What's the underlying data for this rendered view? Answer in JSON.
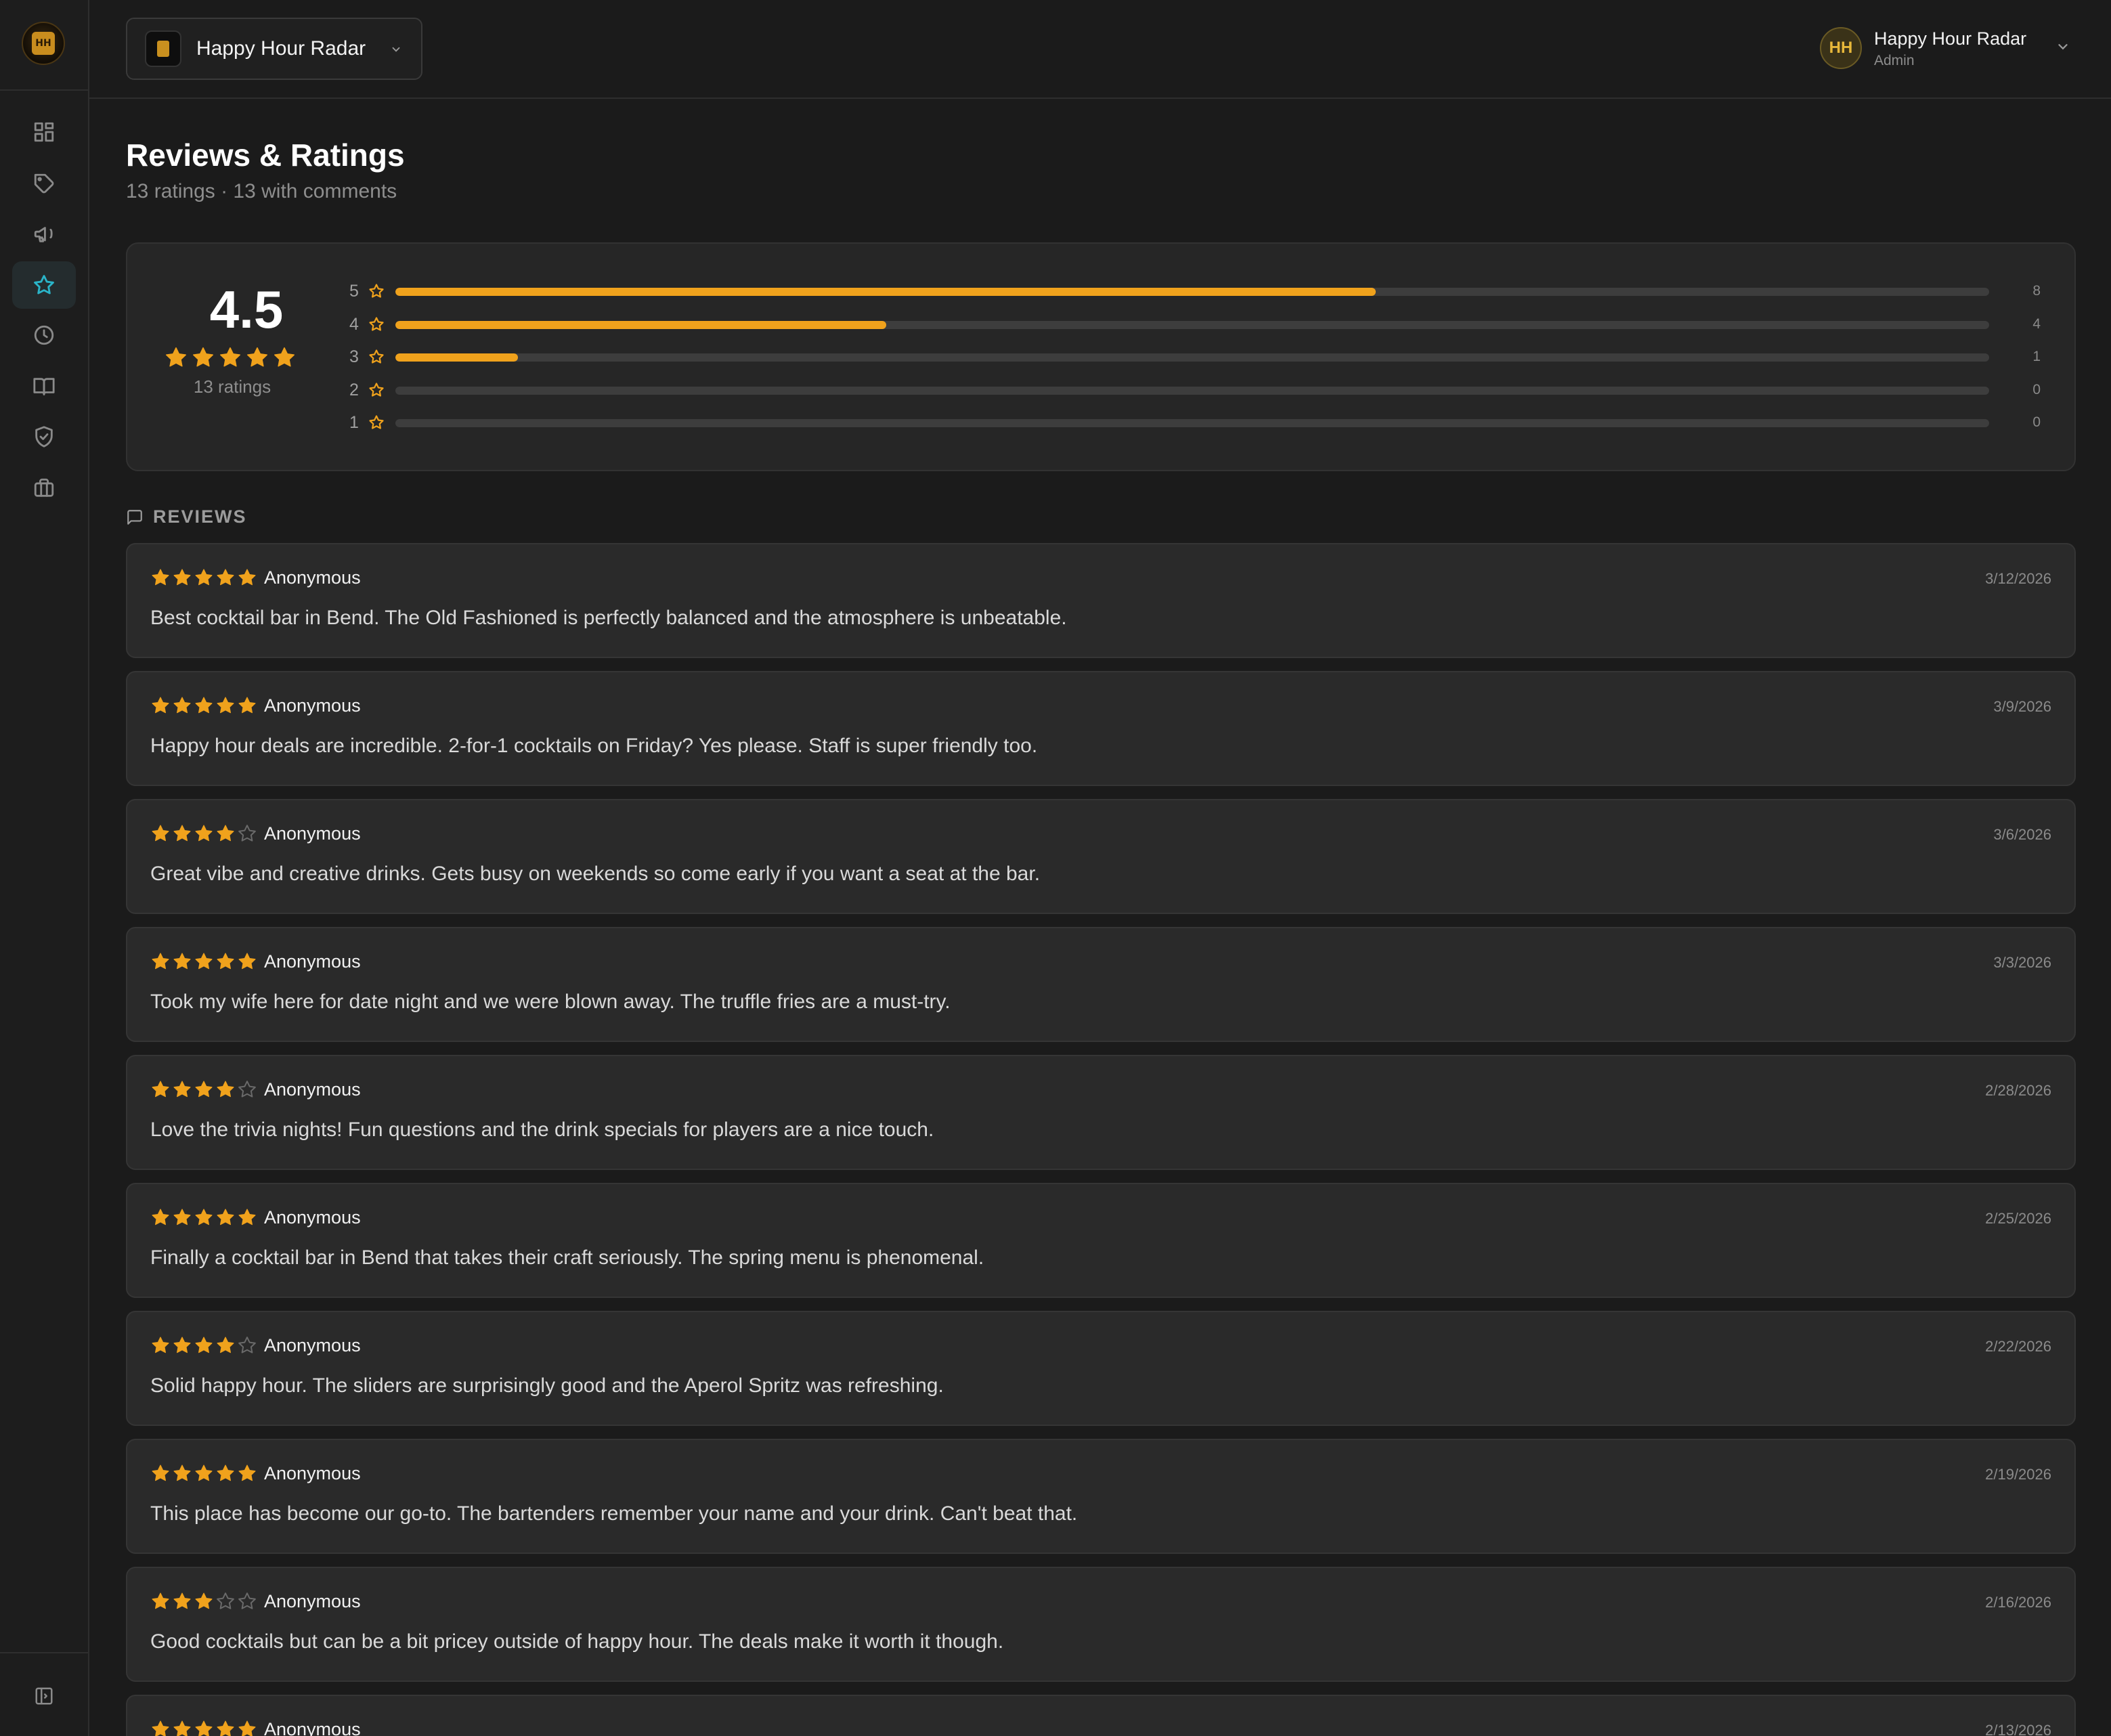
{
  "app": {
    "logo_text": "HH"
  },
  "sidebar": {
    "items": [
      {
        "icon": "dashboard-icon",
        "active": false
      },
      {
        "icon": "tag-icon",
        "active": false
      },
      {
        "icon": "megaphone-icon",
        "active": false
      },
      {
        "icon": "star-icon",
        "active": true
      },
      {
        "icon": "clock-icon",
        "active": false
      },
      {
        "icon": "book-icon",
        "active": false
      },
      {
        "icon": "shield-check-icon",
        "active": false
      },
      {
        "icon": "briefcase-icon",
        "active": false
      }
    ],
    "collapse_icon": "panel-toggle-icon"
  },
  "header": {
    "venue_name": "Happy Hour Radar",
    "user": {
      "initials": "HH",
      "name": "Happy Hour Radar",
      "role": "Admin"
    }
  },
  "page": {
    "title": "Reviews & Ratings",
    "subtitle": "13 ratings · 13 with comments"
  },
  "summary": {
    "average": "4.5",
    "average_stars": 4.5,
    "count_label": "13 ratings",
    "distribution": [
      {
        "stars": "5",
        "count": "8",
        "fraction": 0.615
      },
      {
        "stars": "4",
        "count": "4",
        "fraction": 0.308
      },
      {
        "stars": "3",
        "count": "1",
        "fraction": 0.077
      },
      {
        "stars": "2",
        "count": "0",
        "fraction": 0
      },
      {
        "stars": "1",
        "count": "0",
        "fraction": 0
      }
    ]
  },
  "reviews_section": {
    "label": "REVIEWS"
  },
  "reviews": [
    {
      "rating": 5,
      "author": "Anonymous",
      "date": "3/12/2026",
      "text": "Best cocktail bar in Bend. The Old Fashioned is perfectly balanced and the atmosphere is unbeatable."
    },
    {
      "rating": 5,
      "author": "Anonymous",
      "date": "3/9/2026",
      "text": "Happy hour deals are incredible. 2-for-1 cocktails on Friday? Yes please. Staff is super friendly too."
    },
    {
      "rating": 4,
      "author": "Anonymous",
      "date": "3/6/2026",
      "text": "Great vibe and creative drinks. Gets busy on weekends so come early if you want a seat at the bar."
    },
    {
      "rating": 5,
      "author": "Anonymous",
      "date": "3/3/2026",
      "text": "Took my wife here for date night and we were blown away. The truffle fries are a must-try."
    },
    {
      "rating": 4,
      "author": "Anonymous",
      "date": "2/28/2026",
      "text": "Love the trivia nights! Fun questions and the drink specials for players are a nice touch."
    },
    {
      "rating": 5,
      "author": "Anonymous",
      "date": "2/25/2026",
      "text": "Finally a cocktail bar in Bend that takes their craft seriously. The spring menu is phenomenal."
    },
    {
      "rating": 4,
      "author": "Anonymous",
      "date": "2/22/2026",
      "text": "Solid happy hour. The sliders are surprisingly good and the Aperol Spritz was refreshing."
    },
    {
      "rating": 5,
      "author": "Anonymous",
      "date": "2/19/2026",
      "text": "This place has become our go-to. The bartenders remember your name and your drink. Can't beat that."
    },
    {
      "rating": 3,
      "author": "Anonymous",
      "date": "2/16/2026",
      "text": "Good cocktails but can be a bit pricey outside of happy hour. The deals make it worth it though."
    },
    {
      "rating": 5,
      "author": "Anonymous",
      "date": "2/13/2026",
      "text": ""
    }
  ],
  "colors": {
    "accent_star": "#f0a21c",
    "active_nav": "#2ab4c8",
    "empty_star": "#6a6a6a"
  }
}
